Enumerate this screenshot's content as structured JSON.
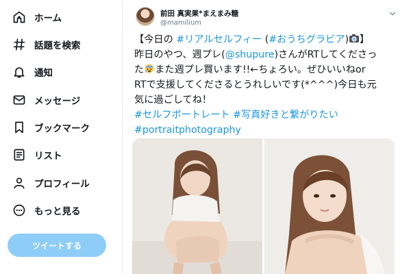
{
  "nav": {
    "items": [
      {
        "label": "ホーム",
        "icon": "home-icon"
      },
      {
        "label": "話題を検索",
        "icon": "hashtag-icon"
      },
      {
        "label": "通知",
        "icon": "bell-icon"
      },
      {
        "label": "メッセージ",
        "icon": "envelope-icon"
      },
      {
        "label": "ブックマーク",
        "icon": "bookmark-icon"
      },
      {
        "label": "リスト",
        "icon": "list-icon"
      },
      {
        "label": "プロフィール",
        "icon": "person-icon"
      },
      {
        "label": "もっと見る",
        "icon": "more-icon"
      }
    ],
    "tweet_button": "ツイートする"
  },
  "tweet": {
    "display_name": "前田 真実果*まえまみ糖",
    "handle": "@mamilium",
    "lines": [
      [
        {
          "t": "【今日の "
        },
        {
          "t": "#リアルセルフィー",
          "h": true
        },
        {
          "t": " ("
        },
        {
          "t": "#おうちグラビア",
          "h": true
        },
        {
          "t": ")"
        },
        {
          "e": "camera-emoji"
        },
        {
          "t": "】"
        }
      ],
      [
        {
          "t": "昨日のやつ、週プレ("
        },
        {
          "t": "@shupure",
          "h": true
        },
        {
          "t": ")さんがRTしてくださっ"
        }
      ],
      [
        {
          "t": "た"
        },
        {
          "e": "crying-face-emoji"
        },
        {
          "t": "また週プレ買います!!←ちょろい。ぜひいいねor"
        }
      ],
      [
        {
          "t": "RTで支援してくださるとうれしいです(*^^^)今日も元"
        }
      ],
      [
        {
          "t": "気に過ごしてね！"
        }
      ],
      [
        {
          "t": "#セルフポートレート",
          "h": true
        },
        {
          "t": " "
        },
        {
          "t": "#写真好きと繋がりたい",
          "h": true
        }
      ],
      [
        {
          "t": "#portraitphotography",
          "h": true
        }
      ]
    ]
  },
  "colors": {
    "link": "#1b95e0",
    "tweet_button_bg": "#8ecdf7",
    "text": "#14171a",
    "muted": "#657786"
  }
}
